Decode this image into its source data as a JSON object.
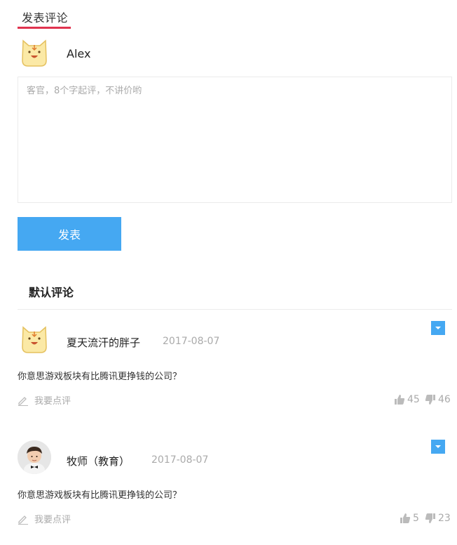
{
  "header": {
    "tab_label": "发表评论"
  },
  "composer": {
    "user_name": "Alex",
    "placeholder": "客官，8个字起评，不讲价哟",
    "submit_label": "发表"
  },
  "comments_section": {
    "title": "默认评论"
  },
  "comments": [
    {
      "author": "夏天流汗的胖子",
      "date": "2017-08-07",
      "text": "你意思游戏板块有比腾讯更挣钱的公司？",
      "reply_label": "我要点评",
      "likes": "45",
      "dislikes": "46",
      "avatar_icon": "cat-cartoon-avatar"
    },
    {
      "author": "牧师（教育）",
      "date": "2017-08-07",
      "text": "你意思游戏板块有比腾讯更挣钱的公司？",
      "reply_label": "我要点评",
      "likes": "5",
      "dislikes": "23",
      "avatar_icon": "child-photo-avatar"
    }
  ],
  "colors": {
    "accent": "#45a8f2",
    "tab_underline": "#e0334f",
    "muted_text": "#aaaaaa"
  }
}
